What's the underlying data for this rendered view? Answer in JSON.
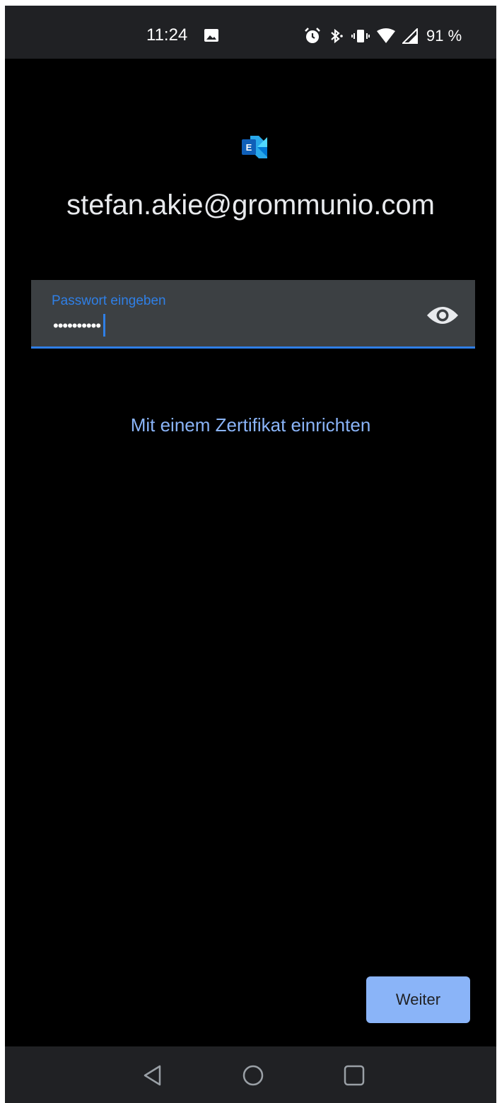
{
  "status_bar": {
    "time": "11:24",
    "battery": "91 %",
    "icons": [
      "gallery-icon",
      "alarm-icon",
      "bluetooth-icon",
      "vibrate-icon",
      "wifi-icon",
      "signal-icon"
    ]
  },
  "app": {
    "logo_icon": "exchange-logo-icon",
    "accent_color": "#2f7fe6",
    "link_color": "#8ab4f8"
  },
  "account": {
    "email": "stefan.akie@grommunio.com"
  },
  "password_field": {
    "label": "Passwort eingeben",
    "value_masked": "••••••••••",
    "toggle_icon": "eye-icon"
  },
  "certificate_link": "Mit einem Zertifikat einrichten",
  "next_button": "Weiter",
  "nav_bar": {
    "icons": [
      "back-icon",
      "home-icon",
      "recents-icon"
    ]
  }
}
